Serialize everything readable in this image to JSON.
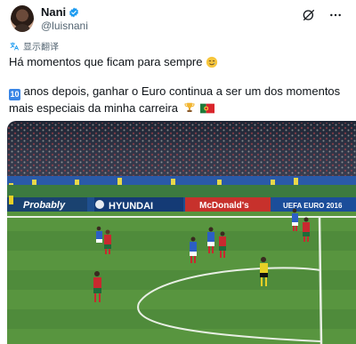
{
  "author": {
    "name": "Nani",
    "handle": "@luisnani",
    "verified_color": "#1d9bf0"
  },
  "translate": {
    "label": "显示翻译",
    "icon": "translate-icon"
  },
  "tweet": {
    "line1": "Há momentos que ficam para sempre",
    "line1_emoji": "smiling-face-with-tear",
    "number_box": "10",
    "line2": " anos depois, ganhar o Euro continua a ser um dos momentos mais especiais da minha carreira",
    "line2_emojis": [
      "trophy",
      "portugal-flag"
    ]
  },
  "media": {
    "boards": {
      "sponsor1": "Probably",
      "sponsor2": "HYUNDAI",
      "sponsor3": "McDonald's",
      "event": "UEFA EURO 2016"
    }
  },
  "colors": {
    "pitch": "#4f8b3b",
    "pitch_dark": "#467f34",
    "board_blue": "#1f4f8f",
    "accent_link": "#1d9bf0"
  }
}
